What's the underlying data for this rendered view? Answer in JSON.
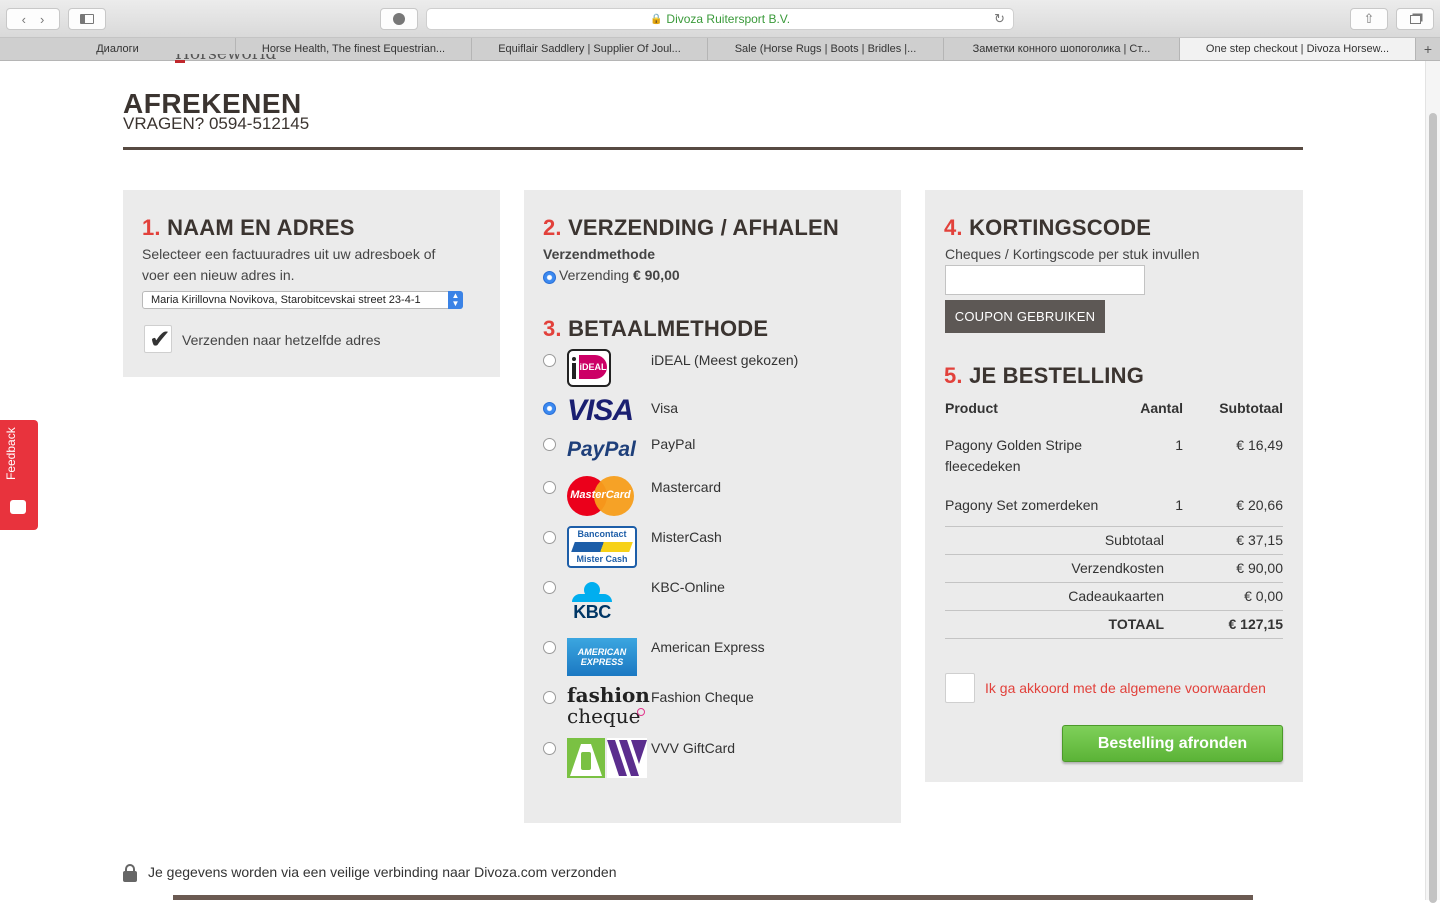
{
  "browser": {
    "url_text": "Divoza Ruitersport B.V.",
    "tabs": [
      {
        "label": "Диалоги"
      },
      {
        "label": "Horse Health, The finest Equestrian..."
      },
      {
        "label": "Equiflair Saddlery | Supplier Of Joul..."
      },
      {
        "label": "Sale (Horse Rugs | Boots | Bridles |..."
      },
      {
        "label": "Заметки конного шопоголика | Ст..."
      },
      {
        "label": "One step checkout | Divoza Horsew..."
      }
    ]
  },
  "header": {
    "logo_fragment": "Horseworld",
    "title": "AFREKENEN",
    "phone": "VRAGEN? 0594-512145"
  },
  "address": {
    "num": "1.",
    "heading": "NAAM EN ADRES",
    "desc_line1": "Selecteer een factuuradres uit uw adresboek of",
    "desc_line2": "voer een nieuw adres in.",
    "selected_address": "Maria Kirillovna Novikova, Starobitcevskai street 23-4-1",
    "same_address_label": "Verzenden naar hetzelfde adres"
  },
  "shipping": {
    "num": "2.",
    "heading": "VERZENDING / AFHALEN",
    "method_label": "Verzendmethode",
    "option_label": "Verzending",
    "option_price": "€ 90,00"
  },
  "payment": {
    "num": "3.",
    "heading": "BETAALMETHODE",
    "methods": [
      {
        "label": "iDEAL (Meest gekozen)",
        "logo_text": "iDEAL"
      },
      {
        "label": "Visa",
        "logo_text": "VISA"
      },
      {
        "label": "PayPal",
        "logo_text": "PayPal"
      },
      {
        "label": "Mastercard",
        "logo_text": "MasterCard"
      },
      {
        "label": "MisterCash",
        "logo_text_1": "Bancontact",
        "logo_text_2": "Mister Cash"
      },
      {
        "label": "KBC-Online",
        "logo_text": "KBC"
      },
      {
        "label": "American Express",
        "logo_text_1": "AMERICAN",
        "logo_text_2": "EXPRESS"
      },
      {
        "label": "Fashion Cheque",
        "logo_text_1": "fashion",
        "logo_text_2": "cheque"
      },
      {
        "label": "VVV GiftCard"
      }
    ]
  },
  "coupon": {
    "num": "4.",
    "heading": "KORTINGSCODE",
    "desc": "Cheques / Kortingscode per stuk invullen",
    "input_value": "",
    "button_label": "COUPON GEBRUIKEN"
  },
  "order": {
    "num": "5.",
    "heading": "JE BESTELLING",
    "col_product": "Product",
    "col_qty": "Aantal",
    "col_subtotal": "Subtotaal",
    "items": [
      {
        "name_line1": "Pagony Golden Stripe",
        "name_line2": "fleecedeken",
        "qty": "1",
        "price": "€ 16,49"
      },
      {
        "name_line1": "Pagony Set zomerdeken",
        "name_line2": "",
        "qty": "1",
        "price": "€ 20,66"
      }
    ],
    "totals": [
      {
        "label": "Subtotaal",
        "value": "€ 37,15"
      },
      {
        "label": "Verzendkosten",
        "value": "€ 90,00"
      },
      {
        "label": "Cadeaukaarten",
        "value": "€ 0,00"
      },
      {
        "label": "TOTAAL",
        "value": "€ 127,15"
      }
    ],
    "agree_label": "Ik ga akkoord met de algemene voorwaarden",
    "finish_label": "Bestelling afronden"
  },
  "footer": {
    "secure_text": "Je gegevens worden via een veilige verbinding naar Divoza.com verzonden"
  },
  "feedback": {
    "label": "Feedback"
  },
  "colors": {
    "accent_red": "#e2413b",
    "finish_green": "#5bb337",
    "panel_gray": "#ebebeb"
  }
}
